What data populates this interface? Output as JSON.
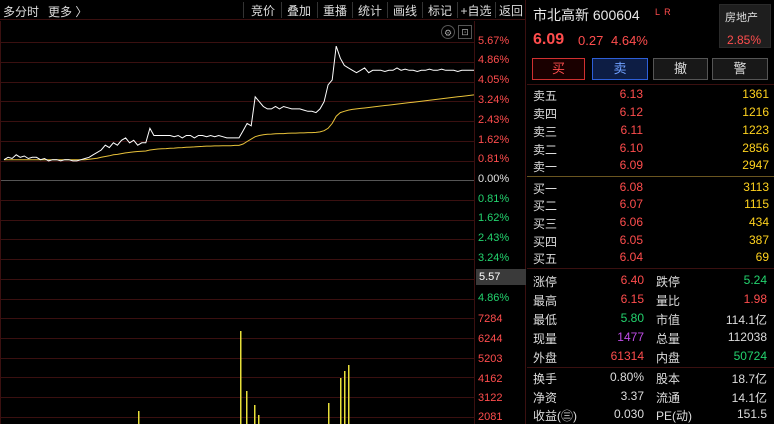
{
  "toolbar": {
    "left_label": "多分时",
    "more": "更多 〉",
    "buttons": [
      "竞价",
      "叠加",
      "重播",
      "统计",
      "画线",
      "标记",
      "+自选",
      "返回"
    ]
  },
  "chart": {
    "y_pct_labels_up": [
      "5.67%",
      "4.86%",
      "4.05%",
      "3.24%",
      "2.43%",
      "1.62%",
      "0.81%"
    ],
    "y_zero_label": "0.00%",
    "y_pct_labels_down": [
      "0.81%",
      "1.62%",
      "2.43%",
      "3.24%",
      "4.86%"
    ],
    "price_marker": "5.57",
    "volume_labels": [
      "7284",
      "6244",
      "5203",
      "4162",
      "3122",
      "2081"
    ],
    "colors": {
      "price_line": "#ffffff",
      "avg_line": "#e8c23a",
      "volume_bar": "#e8e03a",
      "up": "#ff4d4d",
      "down": "#23d36e",
      "grid": "#3a1010"
    }
  },
  "chart_data": {
    "type": "line",
    "title": "",
    "xlabel": "",
    "ylabel": "",
    "ylim_pct": [
      -5.67,
      5.67
    ],
    "series": [
      {
        "values_pct": [
          0.8,
          0.9,
          0.85,
          1.0,
          0.9,
          0.95,
          0.85,
          0.9,
          0.9,
          0.8,
          0.85,
          0.75,
          0.8,
          0.8,
          0.75,
          0.8,
          0.8,
          0.75,
          0.75,
          0.8,
          0.85,
          0.9,
          1.0,
          1.1,
          1.2,
          1.4,
          1.3,
          1.5,
          1.4,
          1.6,
          1.7,
          1.5,
          1.6,
          1.4,
          1.5,
          1.5,
          2.1,
          1.8,
          1.8,
          1.8,
          1.8,
          1.8,
          1.75,
          1.8,
          1.7,
          1.8,
          1.8,
          1.7,
          1.8,
          1.8,
          1.75,
          1.8,
          1.75,
          1.8,
          1.75,
          1.7,
          1.7,
          1.7,
          1.7,
          2.0,
          2.3,
          2.2,
          3.4,
          3.2,
          3.0,
          2.9,
          2.9,
          3.0,
          2.9,
          3.0,
          2.95,
          2.9,
          2.9,
          2.9,
          2.85,
          2.8,
          2.8,
          2.75,
          2.9,
          3.2,
          3.9,
          4.1,
          5.5,
          5.0,
          4.7,
          4.6,
          4.5,
          4.4,
          4.5,
          4.6,
          4.4,
          4.5,
          4.5,
          4.5,
          4.45,
          4.5,
          4.5,
          4.6,
          4.5,
          4.55,
          4.5,
          4.5,
          4.45,
          4.5,
          4.5,
          4.55,
          4.5,
          4.5,
          4.55,
          4.5,
          4.5,
          4.5,
          4.45,
          4.5,
          4.5,
          4.5,
          4.5
        ]
      },
      {
        "values_pct": [
          0.8,
          0.8,
          0.8,
          0.8,
          0.8,
          0.8,
          0.8,
          0.8,
          0.8,
          0.8,
          0.8,
          0.8,
          0.8,
          0.8,
          0.8,
          0.8,
          0.8,
          0.8,
          0.8,
          0.8,
          0.8,
          0.82,
          0.84,
          0.86,
          0.9,
          0.93,
          0.96,
          1.0,
          1.02,
          1.05,
          1.08,
          1.1,
          1.12,
          1.14,
          1.15,
          1.16,
          1.2,
          1.22,
          1.24,
          1.25,
          1.26,
          1.27,
          1.28,
          1.29,
          1.3,
          1.31,
          1.32,
          1.33,
          1.34,
          1.35,
          1.36,
          1.36,
          1.37,
          1.37,
          1.38,
          1.38,
          1.38,
          1.39,
          1.39,
          1.45,
          1.55,
          1.65,
          1.75,
          1.8,
          1.83,
          1.85,
          1.86,
          1.87,
          1.88,
          1.88,
          1.89,
          1.9,
          1.9,
          1.91,
          1.91,
          1.92,
          1.92,
          1.93,
          1.95,
          2.0,
          2.1,
          2.3,
          2.6,
          2.75,
          2.8,
          2.85,
          2.88,
          2.9,
          2.92,
          2.94,
          2.96,
          2.98,
          3.0,
          3.02,
          3.04,
          3.06,
          3.08,
          3.1,
          3.12,
          3.14,
          3.16,
          3.18,
          3.2,
          3.22,
          3.24,
          3.26,
          3.28,
          3.3,
          3.32,
          3.34,
          3.36,
          3.38,
          3.4,
          3.42,
          3.44,
          3.46,
          3.48
        ]
      }
    ]
  },
  "quote": {
    "name": "市北高新",
    "code": "600604",
    "badge": "L R",
    "sector": "房地产",
    "sector_change": "2.85%",
    "price": "6.09",
    "change": "0.27",
    "change_pct": "4.64%"
  },
  "trade_buttons": {
    "buy": "买",
    "sell": "卖",
    "cancel": "撤",
    "alert": "警"
  },
  "order_book": {
    "asks": [
      {
        "label": "卖五",
        "price": "6.13",
        "volume": "1361"
      },
      {
        "label": "卖四",
        "price": "6.12",
        "volume": "1216"
      },
      {
        "label": "卖三",
        "price": "6.11",
        "volume": "1223"
      },
      {
        "label": "卖二",
        "price": "6.10",
        "volume": "2856"
      },
      {
        "label": "卖一",
        "price": "6.09",
        "volume": "2947"
      }
    ],
    "bids": [
      {
        "label": "买一",
        "price": "6.08",
        "volume": "3113"
      },
      {
        "label": "买二",
        "price": "6.07",
        "volume": "1115"
      },
      {
        "label": "买三",
        "price": "6.06",
        "volume": "434"
      },
      {
        "label": "买四",
        "price": "6.05",
        "volume": "387"
      },
      {
        "label": "买五",
        "price": "6.04",
        "volume": "69"
      }
    ]
  },
  "stats": [
    {
      "l1": "涨停",
      "v1": "6.40",
      "c1": "red",
      "l2": "跌停",
      "v2": "5.24",
      "c2": "green"
    },
    {
      "l1": "最高",
      "v1": "6.15",
      "c1": "red",
      "l2": "量比",
      "v2": "1.98",
      "c2": "red"
    },
    {
      "l1": "最低",
      "v1": "5.80",
      "c1": "green",
      "l2": "市值",
      "v2": "114.1亿",
      "c2": "cyan"
    },
    {
      "l1": "现量",
      "v1": "1477",
      "c1": "purple",
      "l2": "总量",
      "v2": "112038",
      "c2": "cyan"
    },
    {
      "l1": "外盘",
      "v1": "61314",
      "c1": "red",
      "l2": "内盘",
      "v2": "50724",
      "c2": "green"
    }
  ],
  "stats2": [
    {
      "l1": "换手",
      "v1": "0.80%",
      "c1": "cyan",
      "l2": "股本",
      "v2": "18.7亿",
      "c2": "cyan"
    },
    {
      "l1": "净资",
      "v1": "3.37",
      "c1": "cyan",
      "l2": "流通",
      "v2": "14.1亿",
      "c2": "cyan"
    },
    {
      "l1": "收益(㊂)",
      "v1": "0.030",
      "c1": "cyan",
      "l2": "PE(动)",
      "v2": "151.5",
      "c2": "cyan"
    }
  ]
}
